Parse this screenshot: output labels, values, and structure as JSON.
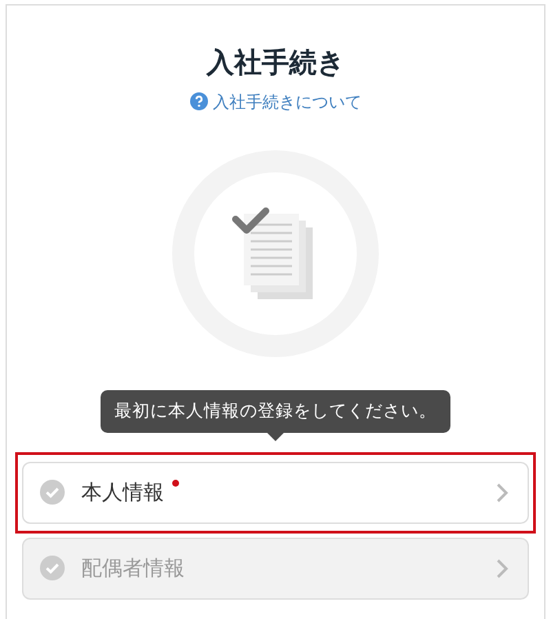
{
  "title": "入社手続き",
  "help_link": {
    "label": "入社手続きについて"
  },
  "tooltip": "最初に本人情報の登録をしてください。",
  "items": [
    {
      "label": "本人情報",
      "required": true,
      "disabled": false,
      "highlighted": true
    },
    {
      "label": "配偶者情報",
      "required": false,
      "disabled": true,
      "highlighted": false
    }
  ]
}
